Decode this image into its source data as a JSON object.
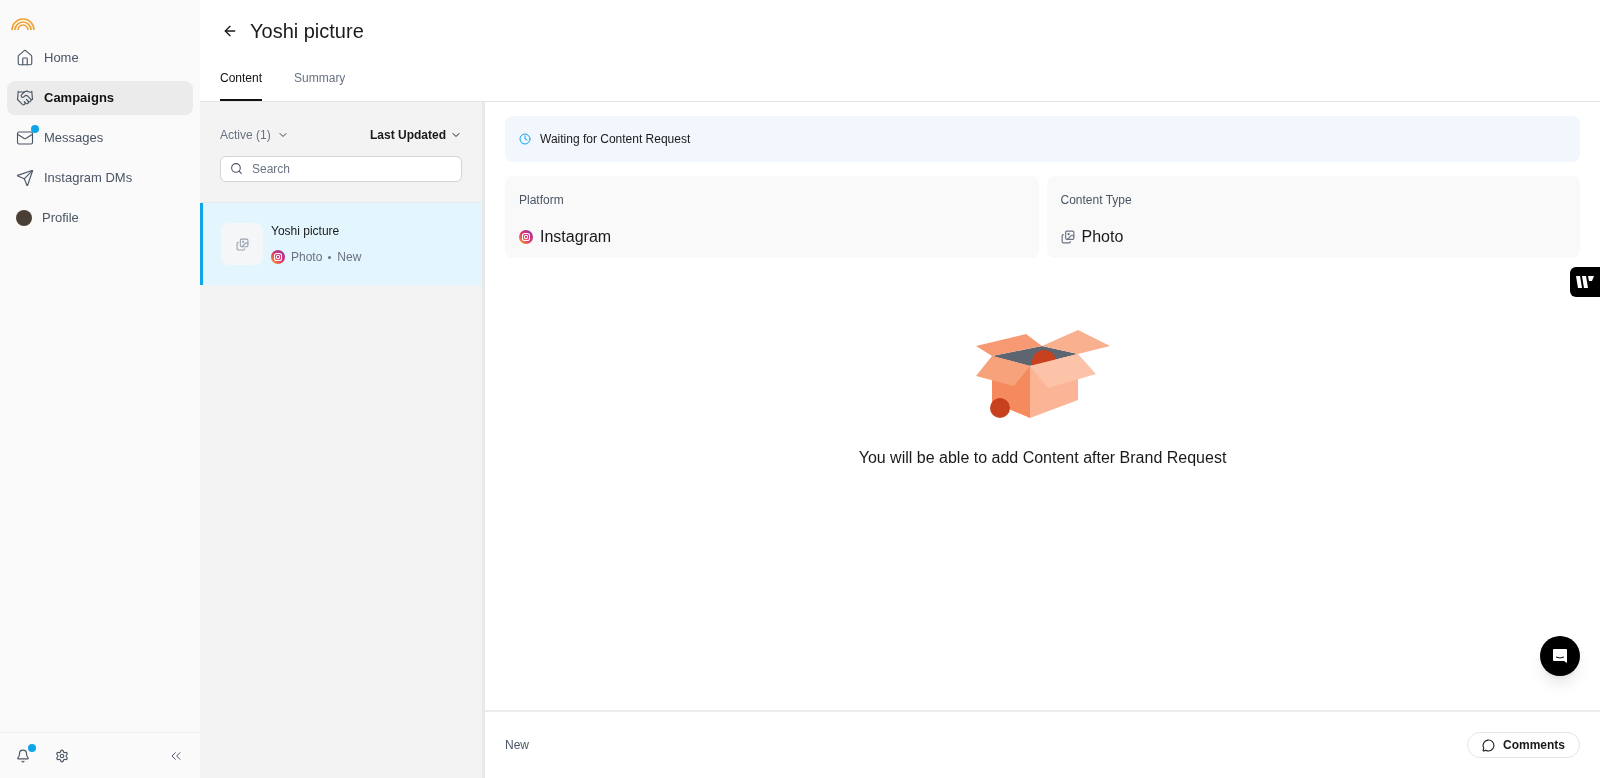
{
  "sidebar": {
    "items": [
      {
        "kind": "home",
        "label": "Home",
        "selected": false,
        "unread": false
      },
      {
        "kind": "campaigns",
        "label": "Campaigns",
        "selected": true,
        "unread": false
      },
      {
        "kind": "messages",
        "label": "Messages",
        "selected": false,
        "unread": true
      },
      {
        "kind": "dms",
        "label": "Instagram DMs",
        "selected": false,
        "unread": false
      },
      {
        "kind": "profile",
        "label": "Profile",
        "selected": false,
        "unread": false
      }
    ],
    "notifications_unread": true
  },
  "page": {
    "title": "Yoshi picture"
  },
  "tabs": [
    {
      "label": "Content",
      "selected": true
    },
    {
      "label": "Summary",
      "selected": false
    }
  ],
  "list": {
    "filter": "Active (1)",
    "sort": "Last Updated",
    "search": {
      "placeholder": "Search"
    },
    "items": [
      {
        "title": "Yoshi picture",
        "type": "Photo",
        "status": "New",
        "selected": true
      }
    ]
  },
  "banner": "Waiting for Content Request",
  "cards": [
    {
      "kind": "platform",
      "label": "Platform",
      "value": "Instagram"
    },
    {
      "kind": "type",
      "label": "Content Type",
      "value": "Photo"
    }
  ],
  "empty_message": "You will be able to add Content after Brand Request",
  "footer": {
    "status": "New",
    "button": "Comments"
  }
}
